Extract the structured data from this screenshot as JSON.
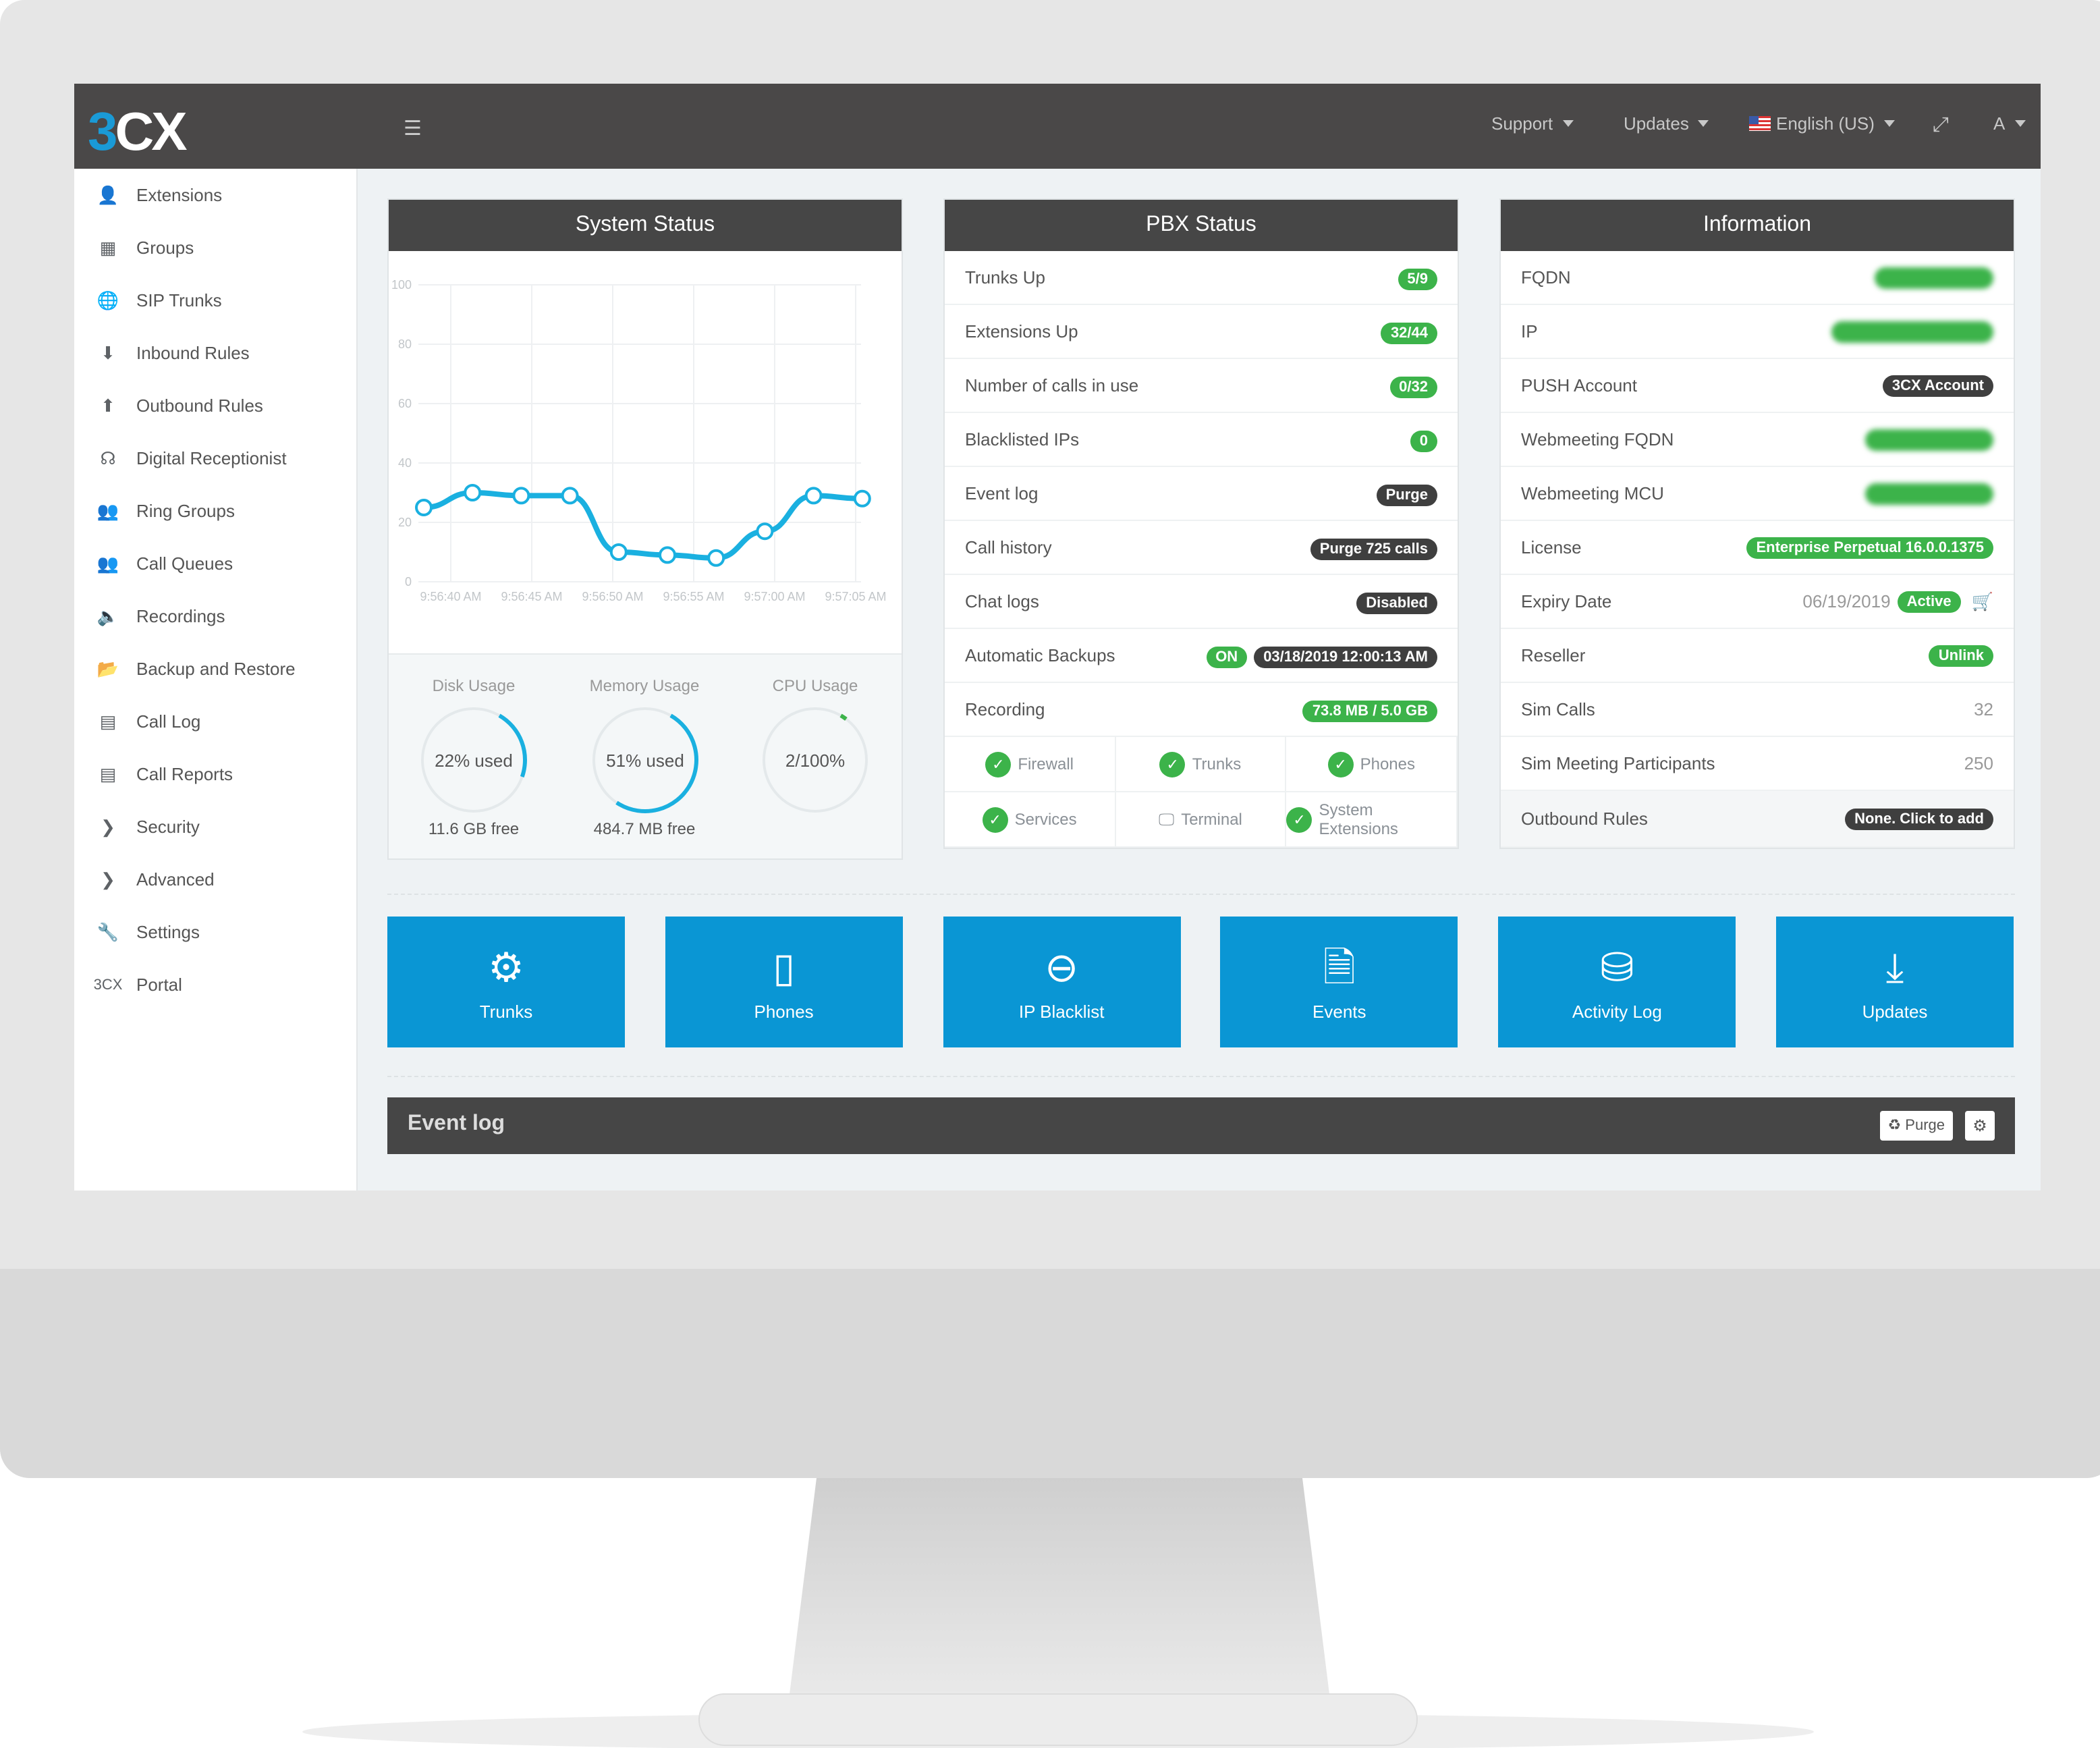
{
  "header": {
    "logo": "3CX",
    "support": "Support",
    "updates": "Updates",
    "language": "English (US)",
    "user": "A"
  },
  "sidebar": {
    "items": [
      {
        "label": "Extensions",
        "icon": "user-icon"
      },
      {
        "label": "Groups",
        "icon": "grid-icon"
      },
      {
        "label": "SIP Trunks",
        "icon": "globe-icon"
      },
      {
        "label": "Inbound Rules",
        "icon": "arrow-down-icon"
      },
      {
        "label": "Outbound Rules",
        "icon": "arrow-up-icon"
      },
      {
        "label": "Digital Receptionist",
        "icon": "headset-icon"
      },
      {
        "label": "Ring Groups",
        "icon": "users-icon"
      },
      {
        "label": "Call Queues",
        "icon": "users-icon"
      },
      {
        "label": "Recordings",
        "icon": "speaker-icon"
      },
      {
        "label": "Backup and Restore",
        "icon": "folder-icon"
      },
      {
        "label": "Call Log",
        "icon": "list-icon"
      },
      {
        "label": "Call Reports",
        "icon": "list-icon"
      },
      {
        "label": "Security",
        "icon": "chevron-right-icon"
      },
      {
        "label": "Advanced",
        "icon": "chevron-right-icon"
      },
      {
        "label": "Settings",
        "icon": "wrench-icon"
      },
      {
        "label": "Portal",
        "icon": "3cx-logo-icon"
      }
    ]
  },
  "system_status": {
    "title": "System Status",
    "gauges": [
      {
        "label": "Disk Usage",
        "value": "22% used",
        "sub": "11.6 GB free",
        "percent": 22,
        "color": "#1ab0e0"
      },
      {
        "label": "Memory Usage",
        "value": "51% used",
        "sub": "484.7 MB free",
        "percent": 51,
        "color": "#1ab0e0"
      },
      {
        "label": "CPU Usage",
        "value": "2/100%",
        "sub": "",
        "percent": 2,
        "color": "#3cb34a"
      }
    ]
  },
  "chart_data": {
    "type": "line",
    "ylim": [
      0,
      100
    ],
    "yticks": [
      0,
      20,
      40,
      60,
      80,
      100
    ],
    "xticks": [
      "9:56:40 AM",
      "9:56:45 AM",
      "9:56:50 AM",
      "9:56:55 AM",
      "9:57:00 AM",
      "9:57:05 AM"
    ],
    "x": [
      "9:56:38",
      "9:56:41",
      "9:56:44",
      "9:56:47",
      "9:56:50",
      "9:56:53",
      "9:56:56",
      "9:56:59",
      "9:57:02",
      "9:57:05"
    ],
    "values": [
      25,
      30,
      29,
      29,
      10,
      9,
      8,
      17,
      29,
      28
    ],
    "grid": true,
    "color": "#1ab0e0"
  },
  "pbx_status": {
    "title": "PBX Status",
    "rows": [
      {
        "label": "Trunks Up",
        "badges": [
          {
            "text": "5/9",
            "style": "g"
          }
        ]
      },
      {
        "label": "Extensions Up",
        "badges": [
          {
            "text": "32/44",
            "style": "g"
          }
        ]
      },
      {
        "label": "Number of calls in use",
        "badges": [
          {
            "text": "0/32",
            "style": "g"
          }
        ]
      },
      {
        "label": "Blacklisted IPs",
        "badges": [
          {
            "text": "0",
            "style": "g"
          }
        ]
      },
      {
        "label": "Event log",
        "badges": [
          {
            "text": "Purge",
            "style": "d"
          }
        ]
      },
      {
        "label": "Call history",
        "badges": [
          {
            "text": "Purge 725 calls",
            "style": "d"
          }
        ]
      },
      {
        "label": "Chat logs",
        "badges": [
          {
            "text": "Disabled",
            "style": "d"
          }
        ]
      },
      {
        "label": "Automatic Backups",
        "badges": [
          {
            "text": "ON",
            "style": "g"
          },
          {
            "text": "03/18/2019 12:00:13 AM",
            "style": "d"
          }
        ]
      },
      {
        "label": "Recording",
        "badges": [
          {
            "text": "73.8 MB / 5.0 GB",
            "style": "g"
          }
        ]
      }
    ],
    "services": [
      {
        "label": "Firewall",
        "ok": true
      },
      {
        "label": "Trunks",
        "ok": true
      },
      {
        "label": "Phones",
        "ok": true
      },
      {
        "label": "Services",
        "ok": true
      },
      {
        "label": "Terminal",
        "ok": false
      },
      {
        "label": "System Extensions",
        "ok": true
      }
    ]
  },
  "information": {
    "title": "Information",
    "rows": [
      {
        "label": "FQDN",
        "blurred": true
      },
      {
        "label": "IP",
        "blurred": true
      },
      {
        "label": "PUSH Account",
        "badges": [
          {
            "text": "3CX Account",
            "style": "d"
          }
        ]
      },
      {
        "label": "Webmeeting FQDN",
        "blurred": true
      },
      {
        "label": "Webmeeting MCU",
        "blurred": true
      },
      {
        "label": "License",
        "badges": [
          {
            "text": "Enterprise Perpetual 16.0.0.1375",
            "style": "g"
          }
        ]
      },
      {
        "label": "Expiry Date",
        "value": "06/19/2019",
        "badges": [
          {
            "text": "Active",
            "style": "g"
          }
        ],
        "cart": true
      },
      {
        "label": "Reseller",
        "badges": [
          {
            "text": "Unlink",
            "style": "g"
          }
        ]
      },
      {
        "label": "Sim Calls",
        "value": "32"
      },
      {
        "label": "Sim Meeting Participants",
        "value": "250"
      },
      {
        "label": "Outbound Rules",
        "badges": [
          {
            "text": "None. Click to add",
            "style": "d"
          }
        ]
      }
    ]
  },
  "tiles": [
    {
      "label": "Trunks",
      "icon": "gear-icon"
    },
    {
      "label": "Phones",
      "icon": "phone-icon"
    },
    {
      "label": "IP Blacklist",
      "icon": "minus-circle-icon"
    },
    {
      "label": "Events",
      "icon": "file-icon"
    },
    {
      "label": "Activity Log",
      "icon": "drive-icon"
    },
    {
      "label": "Updates",
      "icon": "download-icon"
    }
  ],
  "event_log": {
    "title": "Event log",
    "purge": "Purge"
  }
}
